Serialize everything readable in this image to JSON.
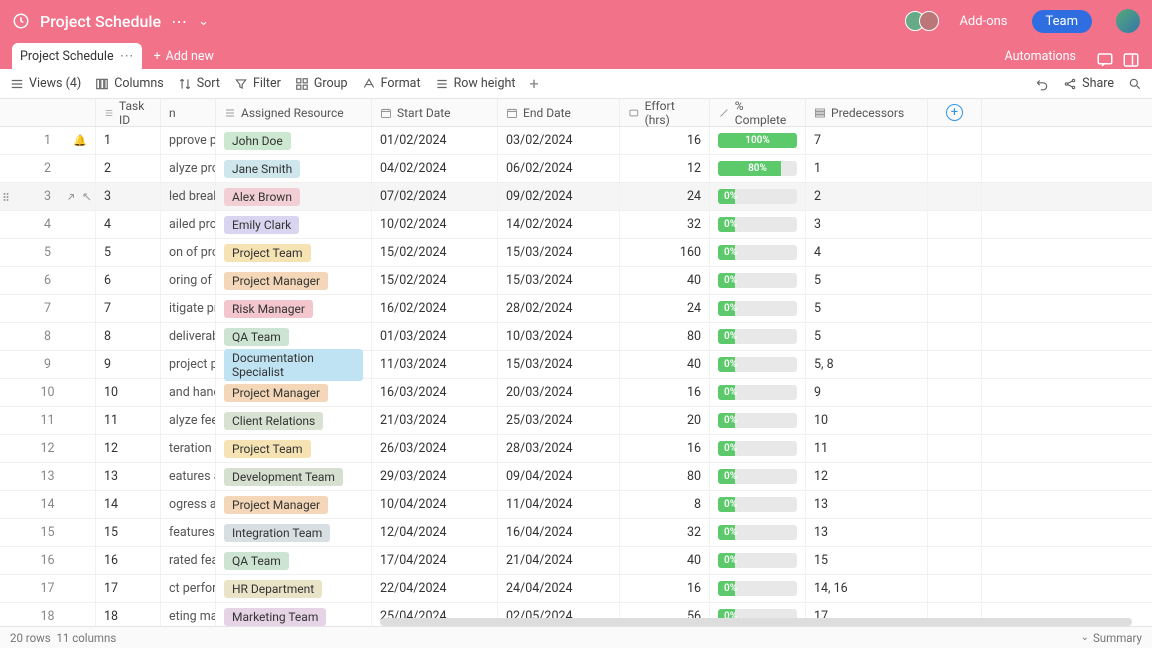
{
  "header": {
    "title": "Project Schedule",
    "addons": "Add-ons",
    "team": "Team"
  },
  "tabs": {
    "name": "Project Schedule",
    "addnew": "Add new"
  },
  "toolbar_right": {
    "automations": "Automations"
  },
  "toolbar": {
    "views": "Views (4)",
    "columns": "Columns",
    "sort": "Sort",
    "filter": "Filter",
    "group": "Group",
    "format": "Format",
    "rowheight": "Row height",
    "share": "Share"
  },
  "columns": {
    "taskid": "Task ID",
    "taskn": "n",
    "res": "Assigned Resource",
    "sdate": "Start Date",
    "edate": "End Date",
    "effort": "Effort (hrs)",
    "pct": "% Complete",
    "pred": "Predecessors"
  },
  "rows": [
    {
      "rn": 1,
      "tid": "1",
      "tn": "pprove pro",
      "res": "John Doe",
      "rescolor": "#cde8d1",
      "sd": "01/02/2024",
      "ed": "03/02/2024",
      "eff": "16",
      "pct": 100,
      "pctlbl": "100%",
      "pred": "7",
      "bell": true
    },
    {
      "rn": 2,
      "tid": "2",
      "tn": "alyze proj",
      "res": "Jane Smith",
      "rescolor": "#cfe7ec",
      "sd": "04/02/2024",
      "ed": "06/02/2024",
      "eff": "12",
      "pct": 80,
      "pctlbl": "80%",
      "pred": "1"
    },
    {
      "rn": 3,
      "tid": "3",
      "tn": "led breakd",
      "res": "Alex Brown",
      "rescolor": "#f2cfd4",
      "sd": "07/02/2024",
      "ed": "09/02/2024",
      "eff": "24",
      "pct": 0,
      "pctlbl": "0%",
      "pred": "2",
      "hovered": true
    },
    {
      "rn": 4,
      "tid": "4",
      "tn": "ailed proje",
      "res": "Emily Clark",
      "rescolor": "#d9d4f0",
      "sd": "10/02/2024",
      "ed": "14/02/2024",
      "eff": "32",
      "pct": 0,
      "pctlbl": "0%",
      "pred": "3"
    },
    {
      "rn": 5,
      "tid": "5",
      "tn": "on of proje",
      "res": "Project Team",
      "rescolor": "#f6e3b4",
      "sd": "15/02/2024",
      "ed": "15/03/2024",
      "eff": "160",
      "pct": 0,
      "pctlbl": "0%",
      "pred": "4"
    },
    {
      "rn": 6,
      "tid": "6",
      "tn": "oring of pr",
      "res": "Project Manager",
      "rescolor": "#f3d7b8",
      "sd": "15/02/2024",
      "ed": "15/03/2024",
      "eff": "40",
      "pct": 0,
      "pctlbl": "0%",
      "pred": "5"
    },
    {
      "rn": 7,
      "tid": "7",
      "tn": "itigate pro",
      "res": "Risk Manager",
      "rescolor": "#f2c6cc",
      "sd": "16/02/2024",
      "ed": "28/02/2024",
      "eff": "24",
      "pct": 0,
      "pctlbl": "0%",
      "pred": "5"
    },
    {
      "rn": 8,
      "tid": "8",
      "tn": "deliverabl",
      "res": "QA Team",
      "rescolor": "#cde4d2",
      "sd": "01/03/2024",
      "ed": "10/03/2024",
      "eff": "80",
      "pct": 0,
      "pctlbl": "0%",
      "pred": "5"
    },
    {
      "rn": 9,
      "tid": "9",
      "tn": "project pro",
      "res": "Documentation Specialist",
      "rescolor": "#bfe3f2",
      "sd": "11/03/2024",
      "ed": "15/03/2024",
      "eff": "40",
      "pct": 0,
      "pctlbl": "0%",
      "pred": "5, 8"
    },
    {
      "rn": 10,
      "tid": "10",
      "tn": "and hand",
      "res": "Project Manager",
      "rescolor": "#f3d7b8",
      "sd": "16/03/2024",
      "ed": "20/03/2024",
      "eff": "16",
      "pct": 0,
      "pctlbl": "0%",
      "pred": "9"
    },
    {
      "rn": 11,
      "tid": "11",
      "tn": "alyze feed",
      "res": "Client Relations",
      "rescolor": "#d7e2d3",
      "sd": "21/03/2024",
      "ed": "25/03/2024",
      "eff": "20",
      "pct": 0,
      "pctlbl": "0%",
      "pred": "10"
    },
    {
      "rn": 12,
      "tid": "12",
      "tn": "teration ba",
      "res": "Project Team",
      "rescolor": "#f6e3b4",
      "sd": "26/03/2024",
      "ed": "28/03/2024",
      "eff": "16",
      "pct": 0,
      "pctlbl": "0%",
      "pred": "11"
    },
    {
      "rn": 13,
      "tid": "13",
      "tn": "eatures as",
      "res": "Development Team",
      "rescolor": "#d6e0d0",
      "sd": "29/03/2024",
      "ed": "09/04/2024",
      "eff": "80",
      "pct": 0,
      "pctlbl": "0%",
      "pred": "12"
    },
    {
      "rn": 14,
      "tid": "14",
      "tn": "ogress and",
      "res": "Project Manager",
      "rescolor": "#f3d7b8",
      "sd": "10/04/2024",
      "ed": "11/04/2024",
      "eff": "8",
      "pct": 0,
      "pctlbl": "0%",
      "pred": "13"
    },
    {
      "rn": 15,
      "tid": "15",
      "tn": "features in",
      "res": "Integration Team",
      "rescolor": "#d8dfe2",
      "sd": "12/04/2024",
      "ed": "16/04/2024",
      "eff": "32",
      "pct": 0,
      "pctlbl": "0%",
      "pred": "13"
    },
    {
      "rn": 16,
      "tid": "16",
      "tn": "rated featu",
      "res": "QA Team",
      "rescolor": "#cde4d2",
      "sd": "17/04/2024",
      "ed": "21/04/2024",
      "eff": "40",
      "pct": 0,
      "pctlbl": "0%",
      "pred": "15"
    },
    {
      "rn": 17,
      "tid": "17",
      "tn": "ct perform",
      "res": "HR Department",
      "rescolor": "#e9e3c8",
      "sd": "22/04/2024",
      "ed": "24/04/2024",
      "eff": "16",
      "pct": 0,
      "pctlbl": "0%",
      "pred": "14, 16"
    },
    {
      "rn": 18,
      "tid": "18",
      "tn": "eting mate",
      "res": "Marketing Team",
      "rescolor": "#e6d3e6",
      "sd": "25/04/2024",
      "ed": "02/05/2024",
      "eff": "56",
      "pct": 0,
      "pctlbl": "0%",
      "pred": "17"
    }
  ],
  "footer": {
    "rows": "20 rows",
    "cols": "11 columns",
    "summary": "Summary"
  }
}
